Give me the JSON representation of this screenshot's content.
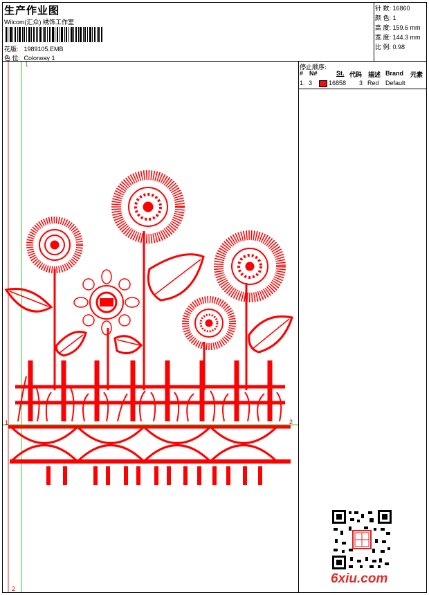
{
  "header": {
    "title": "生产作业图",
    "company": "Wilcom(汇众) 绣饰工作室",
    "design_label": "花版:",
    "design_value": "1989105.EMB",
    "color_label": "色 位:",
    "color_value": "Colorway 1"
  },
  "stats": {
    "stitches_label": "针 数:",
    "stitches_value": "16860",
    "colors_label": "颜 色:",
    "colors_value": "1",
    "height_label": "高 度:",
    "height_value": "159.6 mm",
    "width_label": "宽 度:",
    "width_value": "144.3 mm",
    "scale_label": "比 例:",
    "scale_value": "0.98"
  },
  "stop_sequence": {
    "title": "停止顺序:",
    "headers": [
      "#",
      "N#",
      "St.",
      "代码",
      "描述",
      "Brand",
      "元素"
    ],
    "rows": [
      {
        "index": "1.",
        "needle": "3",
        "stitches": "16858",
        "code": "3",
        "description": "Red",
        "brand": "Default",
        "swatch_color": "#ee1111"
      }
    ]
  },
  "axis_labels": {
    "top_1": "1",
    "left_1": "1",
    "right_2": "2",
    "bottom_2": "2"
  },
  "watermark": "6xiu.com",
  "colors": {
    "embroidery": "#ff0000",
    "guide_green": "#33cc33",
    "guide_red": "#cc0000",
    "watermark": "#e02a2a"
  },
  "icons": {
    "qr": "qr-code-icon",
    "stamp": "seal-stamp-icon"
  }
}
